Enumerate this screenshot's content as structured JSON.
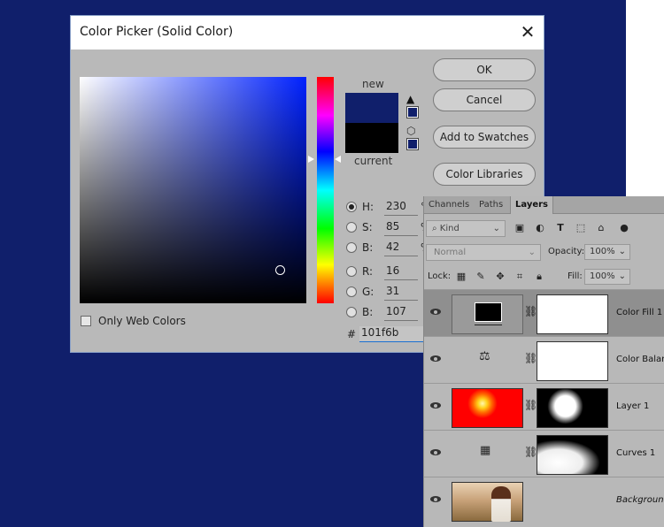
{
  "dialog": {
    "title": "Color Picker (Solid Color)",
    "close_glyph": "✕",
    "new_label": "new",
    "current_label": "current",
    "new_color": "#101f6b",
    "current_color": "#000000",
    "buttons": {
      "ok": "OK",
      "cancel": "Cancel",
      "add_swatches": "Add to Swatches",
      "color_libraries": "Color Libraries"
    },
    "fields": [
      {
        "label": "H:",
        "value": "230",
        "unit": "°",
        "checked": true
      },
      {
        "label": "S:",
        "value": "85",
        "unit": "%",
        "checked": false
      },
      {
        "label": "B:",
        "value": "42",
        "unit": "%",
        "checked": false
      },
      {
        "label": "R:",
        "value": "16",
        "unit": "",
        "checked": false
      },
      {
        "label": "G:",
        "value": "31",
        "unit": "",
        "checked": false
      },
      {
        "label": "B:",
        "value": "107",
        "unit": "",
        "checked": false
      }
    ],
    "hex_prefix": "#",
    "hex_value": "101f6b",
    "web_only_label": "Only Web Colors"
  },
  "layers_panel": {
    "tabs": [
      "Channels",
      "Paths",
      "Layers"
    ],
    "active_tab": "Layers",
    "kind_label": "Kind",
    "blend_mode": "Normal",
    "opacity_label": "Opacity:",
    "opacity_value": "100%",
    "lock_label": "Lock:",
    "fill_label": "Fill:",
    "fill_value": "100%",
    "layers": [
      {
        "name": "Color Fill 1",
        "selected": true
      },
      {
        "name": "Color Balance",
        "selected": false
      },
      {
        "name": "Layer 1",
        "selected": false
      },
      {
        "name": "Curves 1",
        "selected": false
      },
      {
        "name": "Background",
        "selected": false
      }
    ]
  }
}
